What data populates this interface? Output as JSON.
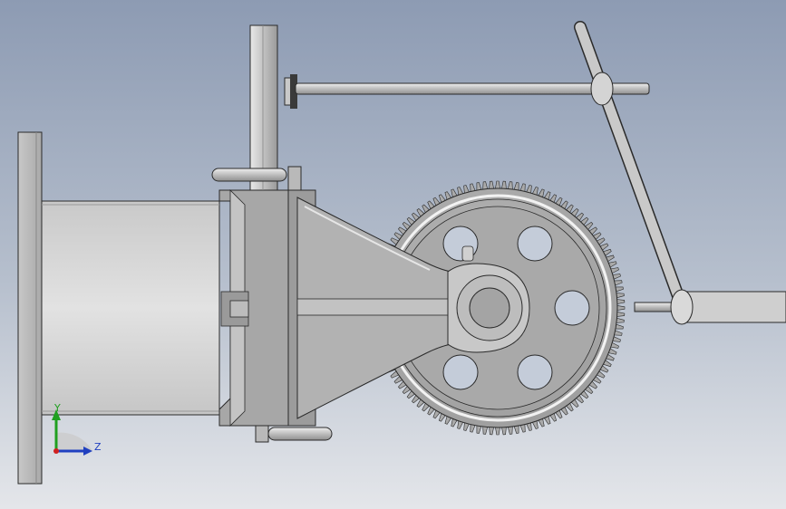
{
  "triad": {
    "y_label": "Y",
    "z_label": "Z"
  },
  "model": {
    "gear_teeth": 120,
    "gear_holes": 6
  },
  "colors": {
    "background_top": "#8d9bb3",
    "background_bottom": "#e4e6ea",
    "metal_light": "#d8d8d8",
    "metal_mid": "#b4b4b4",
    "metal_dark": "#8e8e8e",
    "outline": "#2a2a2a",
    "triad_x": "#d02020",
    "triad_y": "#20a020",
    "triad_z": "#2040c0"
  }
}
